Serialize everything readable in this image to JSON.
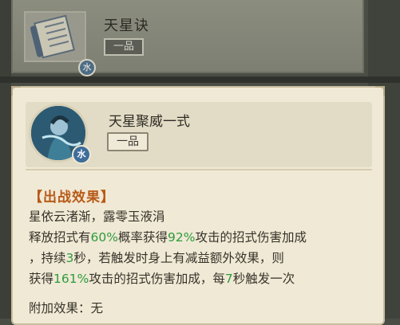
{
  "background_card": {
    "icon": "scroll-icon",
    "element_badge": "水",
    "title": "天星诀",
    "rank": "一品"
  },
  "skill": {
    "avatar_icon": "character-portrait-icon",
    "element_badge": "水",
    "title": "天星聚威一式",
    "rank": "一品"
  },
  "effect": {
    "section_title": "【出战效果】",
    "line1": "星依云渚渐，露零玉液涓",
    "line2_a": "释放招式有",
    "line2_pct1": "60%",
    "line2_b": "概率获得",
    "line2_pct2": "92%",
    "line2_c": "攻击的招式伤害加成",
    "line3_a": "，持续",
    "line3_num": "3",
    "line3_b": "秒，若触发时身上有减益额外效果，则",
    "line4_a": "获得",
    "line4_pct": "161%",
    "line4_b": "攻击的招式伤害加成，每",
    "line4_num": "7",
    "line4_c": "秒触发一次",
    "extra_label": "附加效果：无"
  },
  "colors": {
    "panel_bg": "#f0e9d5",
    "highlight_green": "#2e9b3e",
    "section_title_orange": "#b85a18",
    "water_badge_blue": "#3e6d9b"
  }
}
